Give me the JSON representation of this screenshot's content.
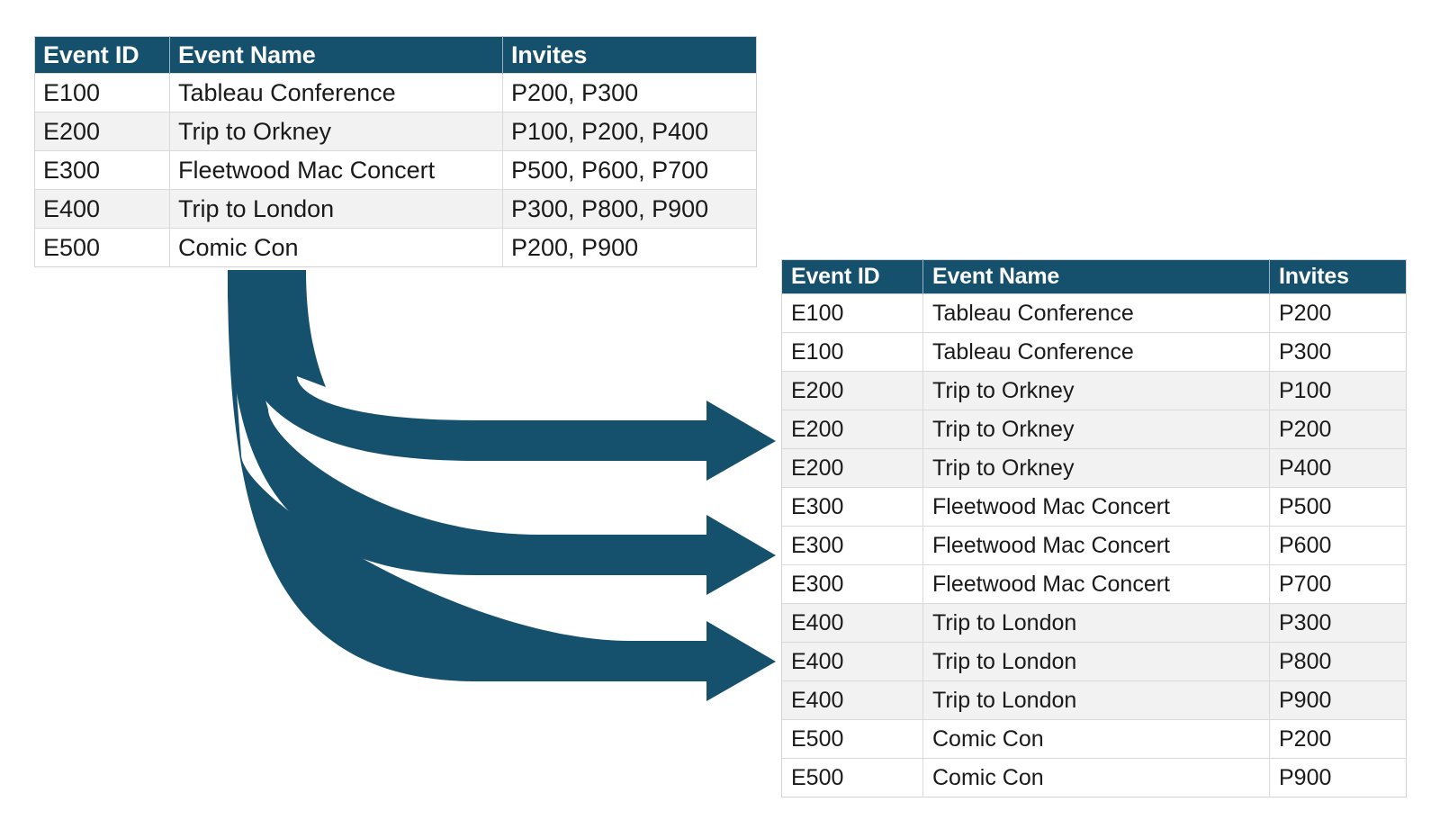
{
  "accent_color": "#15506D",
  "row_shade_color": "#F2F2F2",
  "source_table": {
    "name": "events-with-grouped-invites",
    "columns": [
      "Event ID",
      "Event Name",
      "Invites"
    ],
    "rows": [
      {
        "event_id": "E100",
        "event_name": "Tableau Conference",
        "invites": "P200, P300"
      },
      {
        "event_id": "E200",
        "event_name": "Trip to Orkney",
        "invites": "P100, P200, P400"
      },
      {
        "event_id": "E300",
        "event_name": "Fleetwood Mac Concert",
        "invites": "P500, P600, P700"
      },
      {
        "event_id": "E400",
        "event_name": "Trip to London",
        "invites": "P300, P800, P900"
      },
      {
        "event_id": "E500",
        "event_name": "Comic Con",
        "invites": "P200, P900"
      }
    ]
  },
  "result_table": {
    "name": "events-split-one-invite-per-row",
    "columns": [
      "Event ID",
      "Event Name",
      "Invites"
    ],
    "rows": [
      {
        "event_id": "E100",
        "event_name": "Tableau Conference",
        "invites": "P200"
      },
      {
        "event_id": "E100",
        "event_name": "Tableau Conference",
        "invites": "P300"
      },
      {
        "event_id": "E200",
        "event_name": "Trip to Orkney",
        "invites": "P100"
      },
      {
        "event_id": "E200",
        "event_name": "Trip to Orkney",
        "invites": "P200"
      },
      {
        "event_id": "E200",
        "event_name": "Trip to Orkney",
        "invites": "P400"
      },
      {
        "event_id": "E300",
        "event_name": "Fleetwood Mac Concert",
        "invites": "P500"
      },
      {
        "event_id": "E300",
        "event_name": "Fleetwood Mac Concert",
        "invites": "P600"
      },
      {
        "event_id": "E300",
        "event_name": "Fleetwood Mac Concert",
        "invites": "P700"
      },
      {
        "event_id": "E400",
        "event_name": "Trip to London",
        "invites": "P300"
      },
      {
        "event_id": "E400",
        "event_name": "Trip to London",
        "invites": "P800"
      },
      {
        "event_id": "E400",
        "event_name": "Trip to London",
        "invites": "P900"
      },
      {
        "event_id": "E500",
        "event_name": "Comic Con",
        "invites": "P200"
      },
      {
        "event_id": "E500",
        "event_name": "Comic Con",
        "invites": "P900"
      }
    ]
  },
  "flow": {
    "name": "split-fan-out-arrows",
    "arrow_count": 3,
    "color": "#15506D"
  }
}
